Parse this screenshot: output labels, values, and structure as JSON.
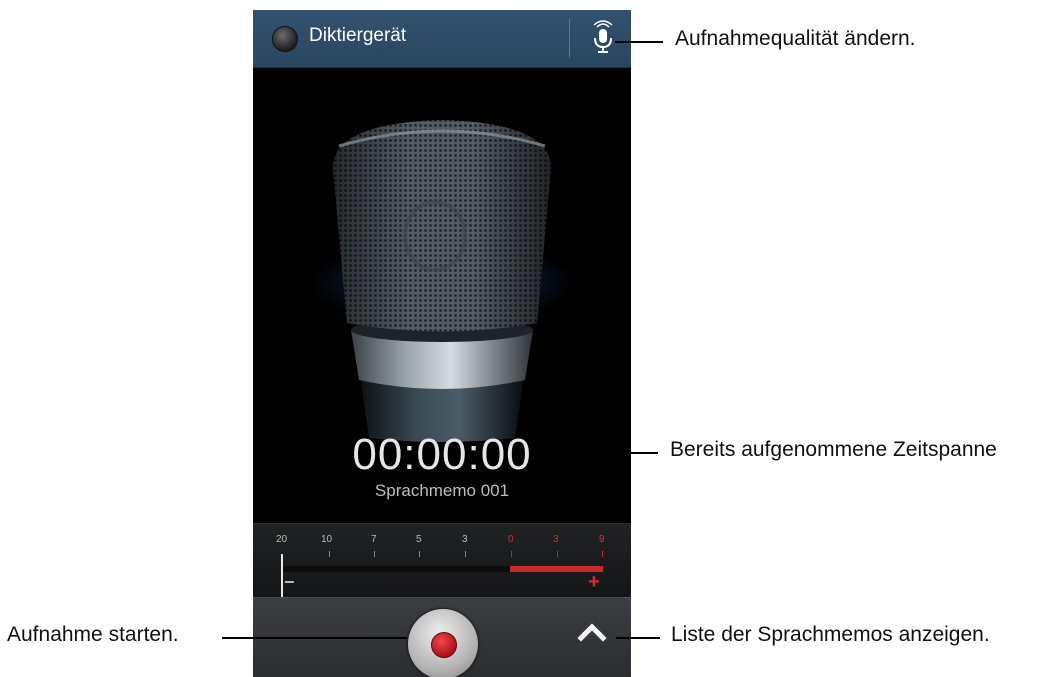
{
  "app": {
    "title": "Diktiergerät",
    "accent_color": "#2f4c68",
    "header_icons": [
      "app-circle-icon",
      "mic-quality-icon"
    ]
  },
  "recorder": {
    "elapsed_time": "00:00:00",
    "memo_name": "Sprachmemo 001"
  },
  "level_meter": {
    "scale_labels": [
      "20",
      "10",
      "7",
      "5",
      "3",
      "0",
      "3",
      "9"
    ],
    "minus_label": "−",
    "plus_label": "+",
    "level": 0,
    "warning_color": "#c92a2a"
  },
  "controls": {
    "record_icon": "record-icon",
    "list_icon": "chevron-up-icon"
  },
  "callouts": {
    "quality": "Aufnahmequalität ändern.",
    "elapsed": "Bereits aufgenommene Zeitspanne",
    "record": "Aufnahme starten.",
    "list": "Liste der Sprachmemos anzeigen."
  }
}
